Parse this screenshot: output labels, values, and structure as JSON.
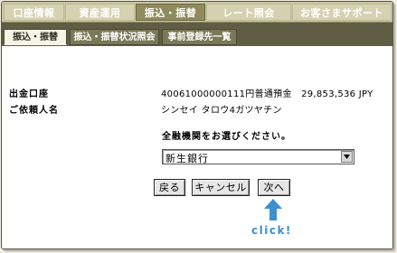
{
  "main_nav": {
    "tabs": [
      {
        "label": "口座情報"
      },
      {
        "label": "資産運用"
      },
      {
        "label": "振込・振替",
        "active": true
      },
      {
        "label": "レート照会"
      },
      {
        "label": "お客さまサポート"
      }
    ]
  },
  "sub_nav": {
    "tabs": [
      {
        "label": "振込・振替",
        "active": true
      },
      {
        "label": "振込・振替状況照会"
      },
      {
        "label": "事前登録先一覧"
      }
    ]
  },
  "account": {
    "withdrawal_label": "出金口座",
    "withdrawal_value": "40061000000111円普通預金　29,853,536 JPY",
    "requester_label": "ご依頼人名",
    "requester_value": "シンセイ タロウ4ガツヤチン"
  },
  "bank_select": {
    "prompt": "全融機関をお選びください。",
    "selected": "新生銀行"
  },
  "buttons": {
    "back": "戻る",
    "cancel": "キャンセル",
    "next": "次へ"
  },
  "annotation": {
    "caption": "click!",
    "color": "#3f8fcf"
  },
  "colors": {
    "tab_active": "#8f8b5c",
    "subnav_bg": "#5f5d43"
  }
}
